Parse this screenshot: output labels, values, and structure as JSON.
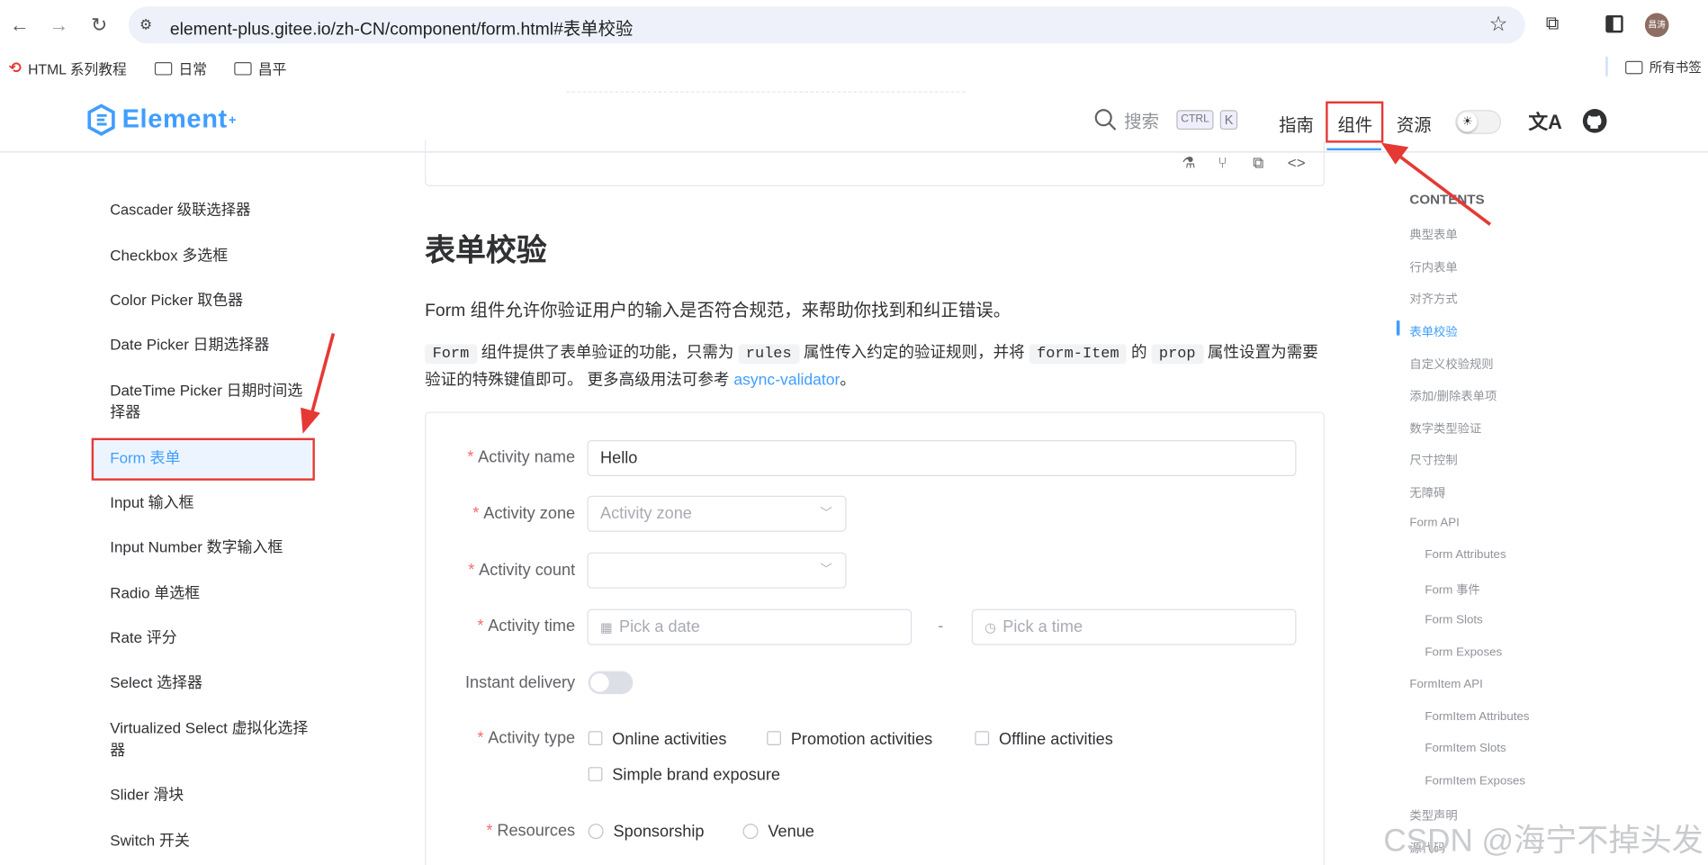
{
  "browser": {
    "url": "element-plus.gitee.io/zh-CN/component/form.html#表单校验",
    "profile_label": "昌涛",
    "bookmarks": [
      {
        "label": "HTML 系列教程",
        "icon": "html-logo-icon"
      },
      {
        "label": "日常",
        "icon": "folder-icon"
      },
      {
        "label": "昌平",
        "icon": "folder-icon"
      }
    ],
    "all_bookmarks": "所有书签"
  },
  "header": {
    "logo_text": "Element",
    "logo_sup": "+",
    "search_label": "搜索",
    "kbd_ctrl": "CTRL",
    "kbd_k": "K",
    "nav": [
      "指南",
      "组件",
      "资源"
    ],
    "active_nav": "组件",
    "translate_glyph": "文A"
  },
  "sidebar": {
    "items": [
      "Cascader 级联选择器",
      "Checkbox 多选框",
      "Color Picker 取色器",
      "Date Picker 日期选择器",
      "DateTime Picker 日期时间选择器",
      "Form 表单",
      "Input 输入框",
      "Input Number 数字输入框",
      "Radio 单选框",
      "Rate 评分",
      "Select 选择器",
      "Virtualized Select 虚拟化选择器",
      "Slider 滑块",
      "Switch 开关"
    ],
    "active": "Form 表单"
  },
  "main": {
    "title": "表单校验",
    "intro": "Form 组件允许你验证用户的输入是否符合规范，来帮助你找到和纠正错误。",
    "desc": {
      "code1": "Form",
      "t1": " 组件提供了表单验证的功能，只需为 ",
      "code2": "rules",
      "t2": " 属性传入约定的验证规则，并将 ",
      "code3": "form-Item",
      "t3": " 的 ",
      "code4": "prop",
      "t4": " 属性设置为需要验证的特殊键值即可。 更多高级用法可参考 ",
      "link": "async-validator",
      "t5": "。"
    },
    "form": {
      "name_label": "Activity name",
      "name_value": "Hello",
      "zone_label": "Activity zone",
      "zone_placeholder": "Activity zone",
      "count_label": "Activity count",
      "count_value": "",
      "time_label": "Activity time",
      "date_placeholder": "Pick a date",
      "time_sep": "-",
      "time_placeholder": "Pick a time",
      "delivery_label": "Instant delivery",
      "type_label": "Activity type",
      "type_options": [
        "Online activities",
        "Promotion activities",
        "Offline activities",
        "Simple brand exposure"
      ],
      "resources_label": "Resources",
      "resources_options": [
        "Sponsorship",
        "Venue"
      ]
    }
  },
  "toc": {
    "heading": "CONTENTS",
    "items": [
      {
        "label": "典型表单",
        "level": 1
      },
      {
        "label": "行内表单",
        "level": 1
      },
      {
        "label": "对齐方式",
        "level": 1
      },
      {
        "label": "表单校验",
        "level": 1,
        "active": true
      },
      {
        "label": "自定义校验规则",
        "level": 1
      },
      {
        "label": "添加/删除表单项",
        "level": 1
      },
      {
        "label": "数字类型验证",
        "level": 1
      },
      {
        "label": "尺寸控制",
        "level": 1
      },
      {
        "label": "无障碍",
        "level": 1
      },
      {
        "label": "Form API",
        "level": 1
      },
      {
        "label": "Form Attributes",
        "level": 2
      },
      {
        "label": "Form 事件",
        "level": 2
      },
      {
        "label": "Form Slots",
        "level": 2
      },
      {
        "label": "Form Exposes",
        "level": 2
      },
      {
        "label": "FormItem API",
        "level": 1
      },
      {
        "label": "FormItem Attributes",
        "level": 2
      },
      {
        "label": "FormItem Slots",
        "level": 2
      },
      {
        "label": "FormItem Exposes",
        "level": 2
      },
      {
        "label": "类型声明",
        "level": 1
      },
      {
        "label": "源代码",
        "level": 1
      }
    ]
  },
  "watermark": "CSDN @海宁不掉头发",
  "colors": {
    "accent": "#409eff",
    "annotation": "#e53935",
    "required": "#f56c6c"
  }
}
